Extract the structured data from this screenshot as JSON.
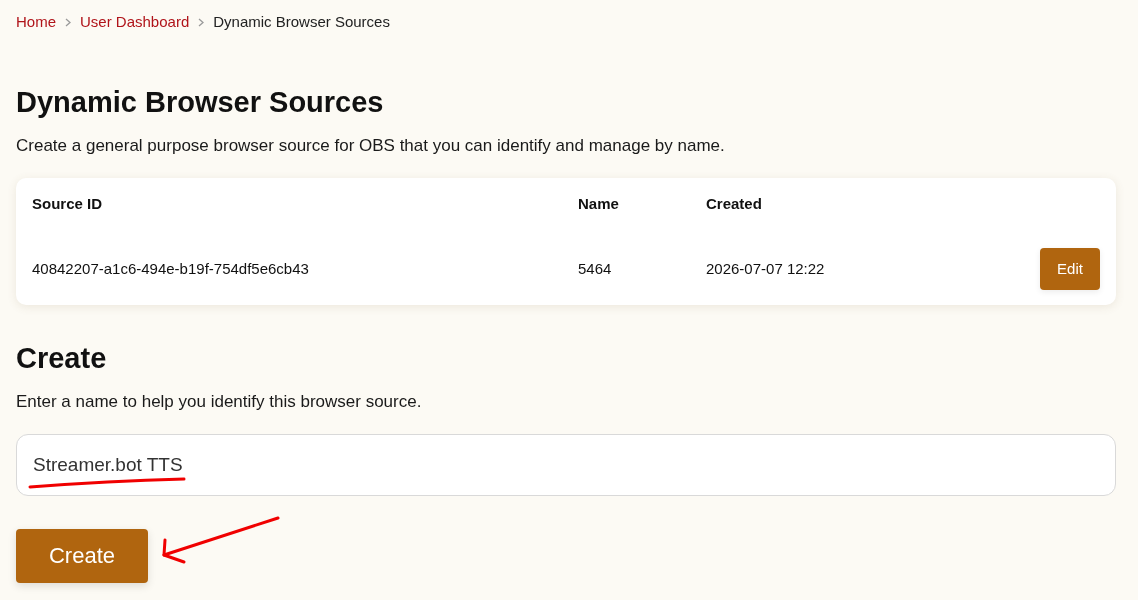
{
  "breadcrumb": [
    {
      "label": "Home",
      "kind": "link"
    },
    {
      "label": "User Dashboard",
      "kind": "link"
    },
    {
      "label": "Dynamic Browser Sources",
      "kind": "current"
    }
  ],
  "page": {
    "title": "Dynamic Browser Sources",
    "description": "Create a general purpose browser source for OBS that you can identify and manage by name."
  },
  "table": {
    "columns": [
      "Source ID",
      "Name",
      "Created"
    ],
    "rows": [
      {
        "cells": [
          "40842207-a1c6-494e-b19f-754df5e6cb43",
          "5464",
          "2026-07-07 12:22"
        ],
        "action": "Edit"
      }
    ]
  },
  "create": {
    "title": "Create",
    "description": "Enter a name to help you identify this browser source.",
    "name_value": "Streamer.bot TTS",
    "button": "Create"
  },
  "annotations": {
    "input_underline": true,
    "button_arrow": true
  }
}
